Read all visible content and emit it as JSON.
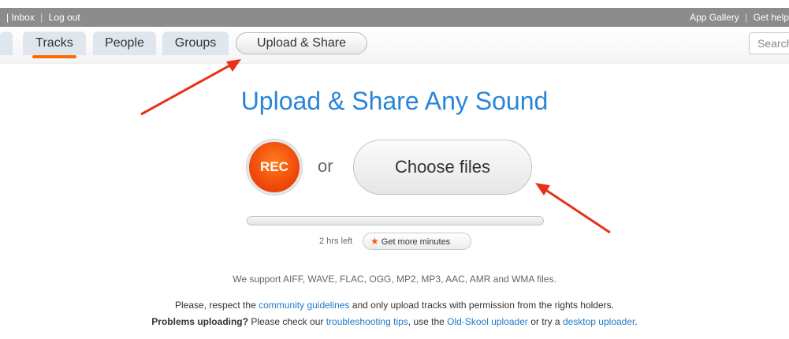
{
  "topbar": {
    "left_sep": "|",
    "inbox": "Inbox",
    "logout": "Log out",
    "app_gallery": "App Gallery",
    "get_help": "Get help"
  },
  "nav": {
    "tracks": "Tracks",
    "people": "People",
    "groups": "Groups",
    "upload_share": "Upload & Share",
    "search_placeholder": "Search"
  },
  "main": {
    "heading": "Upload & Share Any Sound",
    "rec_label": "REC",
    "or": "or",
    "choose_files": "Choose files",
    "upload_progress": 0,
    "hrs_left": "2 hrs left",
    "get_more_minutes": "Get more minutes",
    "supported_formats": "We support AIFF, WAVE, FLAC, OGG, MP2, MP3, AAC, AMR and WMA files.",
    "respect_prefix": "Please, respect the",
    "community_guidelines": "community guidelines",
    "respect_suffix": "and only upload tracks with permission from the rights holders.",
    "problems_bold": "Problems uploading?",
    "problems_text": "Please check our",
    "troubleshooting_tips": "troubleshooting tips",
    "use_the": ", use the",
    "old_skool": "Old-Skool uploader",
    "or_try": "or try a",
    "desktop_uploader": "desktop uploader",
    "period": "."
  },
  "colors": {
    "accent": "#2a85d8",
    "rec": "#f04a0a",
    "annotation_arrow": "#e8311a"
  }
}
